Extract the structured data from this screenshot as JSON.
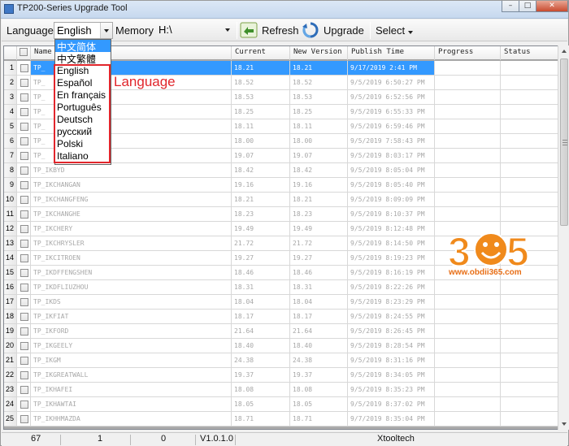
{
  "window": {
    "title": "TP200-Series Upgrade Tool",
    "controls": {
      "minimize": "–",
      "maximize": "□",
      "close": "✕"
    }
  },
  "toolbar": {
    "language_label": "Language",
    "language_value": "English",
    "memory_label": "Memory",
    "memory_value": "H:\\",
    "refresh_label": "Refresh",
    "upgrade_label": "Upgrade",
    "select_label": "Select"
  },
  "language_dropdown": {
    "options": [
      "中文简体",
      "中文繁體",
      "English",
      "Español",
      "En français",
      "Português",
      "Deutsch",
      "русский",
      "Polski",
      "Italiano"
    ],
    "highlighted_index": 0,
    "annotation": "Language"
  },
  "table": {
    "columns": [
      "Name",
      "Current",
      "New Version",
      "Publish Time",
      "Progress",
      "Status"
    ],
    "selected_row": 1,
    "rows": [
      {
        "n": "1",
        "name": "TP_",
        "current": "18.21",
        "new": "18.21",
        "time": "9/17/2019 2:41 PM"
      },
      {
        "n": "2",
        "name": "TP_",
        "current": "18.52",
        "new": "18.52",
        "time": "9/5/2019 6:50:27 PM"
      },
      {
        "n": "3",
        "name": "TP_",
        "current": "18.53",
        "new": "18.53",
        "time": "9/5/2019 6:52:56 PM"
      },
      {
        "n": "4",
        "name": "TP_",
        "current": "18.25",
        "new": "18.25",
        "time": "9/5/2019 6:55:33 PM"
      },
      {
        "n": "5",
        "name": "TP_",
        "current": "18.11",
        "new": "18.11",
        "time": "9/5/2019 6:59:46 PM"
      },
      {
        "n": "6",
        "name": "TP_",
        "current": "18.00",
        "new": "18.00",
        "time": "9/5/2019 7:58:43 PM"
      },
      {
        "n": "7",
        "name": "TP_",
        "current": "19.07",
        "new": "19.07",
        "time": "9/5/2019 8:03:17 PM"
      },
      {
        "n": "8",
        "name": "TP_IKBYD",
        "current": "18.42",
        "new": "18.42",
        "time": "9/5/2019 8:05:04 PM"
      },
      {
        "n": "9",
        "name": "TP_IKCHANGAN",
        "current": "19.16",
        "new": "19.16",
        "time": "9/5/2019 8:05:40 PM"
      },
      {
        "n": "10",
        "name": "TP_IKCHANGFENG",
        "current": "18.21",
        "new": "18.21",
        "time": "9/5/2019 8:09:09 PM"
      },
      {
        "n": "11",
        "name": "TP_IKCHANGHE",
        "current": "18.23",
        "new": "18.23",
        "time": "9/5/2019 8:10:37 PM"
      },
      {
        "n": "12",
        "name": "TP_IKCHERY",
        "current": "19.49",
        "new": "19.49",
        "time": "9/5/2019 8:12:48 PM"
      },
      {
        "n": "13",
        "name": "TP_IKCHRYSLER",
        "current": "21.72",
        "new": "21.72",
        "time": "9/5/2019 8:14:50 PM"
      },
      {
        "n": "14",
        "name": "TP_IKCITROEN",
        "current": "19.27",
        "new": "19.27",
        "time": "9/5/2019 8:19:23 PM"
      },
      {
        "n": "15",
        "name": "TP_IKDFFENGSHEN",
        "current": "18.46",
        "new": "18.46",
        "time": "9/5/2019 8:16:19 PM"
      },
      {
        "n": "16",
        "name": "TP_IKDFLIUZHOU",
        "current": "18.31",
        "new": "18.31",
        "time": "9/5/2019 8:22:26 PM"
      },
      {
        "n": "17",
        "name": "TP_IKDS",
        "current": "18.04",
        "new": "18.04",
        "time": "9/5/2019 8:23:29 PM"
      },
      {
        "n": "18",
        "name": "TP_IKFIAT",
        "current": "18.17",
        "new": "18.17",
        "time": "9/5/2019 8:24:55 PM"
      },
      {
        "n": "19",
        "name": "TP_IKFORD",
        "current": "21.64",
        "new": "21.64",
        "time": "9/5/2019 8:26:45 PM"
      },
      {
        "n": "20",
        "name": "TP_IKGEELY",
        "current": "18.40",
        "new": "18.40",
        "time": "9/5/2019 8:28:54 PM"
      },
      {
        "n": "21",
        "name": "TP_IKGM",
        "current": "24.38",
        "new": "24.38",
        "time": "9/5/2019 8:31:16 PM"
      },
      {
        "n": "22",
        "name": "TP_IKGREATWALL",
        "current": "19.37",
        "new": "19.37",
        "time": "9/5/2019 8:34:05 PM"
      },
      {
        "n": "23",
        "name": "TP_IKHAFEI",
        "current": "18.08",
        "new": "18.08",
        "time": "9/5/2019 8:35:23 PM"
      },
      {
        "n": "24",
        "name": "TP_IKHAWTAI",
        "current": "18.05",
        "new": "18.05",
        "time": "9/5/2019 8:37:02 PM"
      },
      {
        "n": "25",
        "name": "TP_IKHHMAZDA",
        "current": "18.71",
        "new": "18.71",
        "time": "9/7/2019 8:35:04 PM"
      }
    ]
  },
  "watermark": {
    "digits": [
      "3",
      "6",
      "5"
    ],
    "url": "www.obdii365.com"
  },
  "statusbar": {
    "total": "67",
    "selected": "1",
    "done": "0",
    "version": "V1.0.1.0",
    "brand": "Xtooltech"
  },
  "colors": {
    "selection": "#3399ff",
    "annotation_red": "#e1262c",
    "watermark_orange": "#f08a1c"
  }
}
